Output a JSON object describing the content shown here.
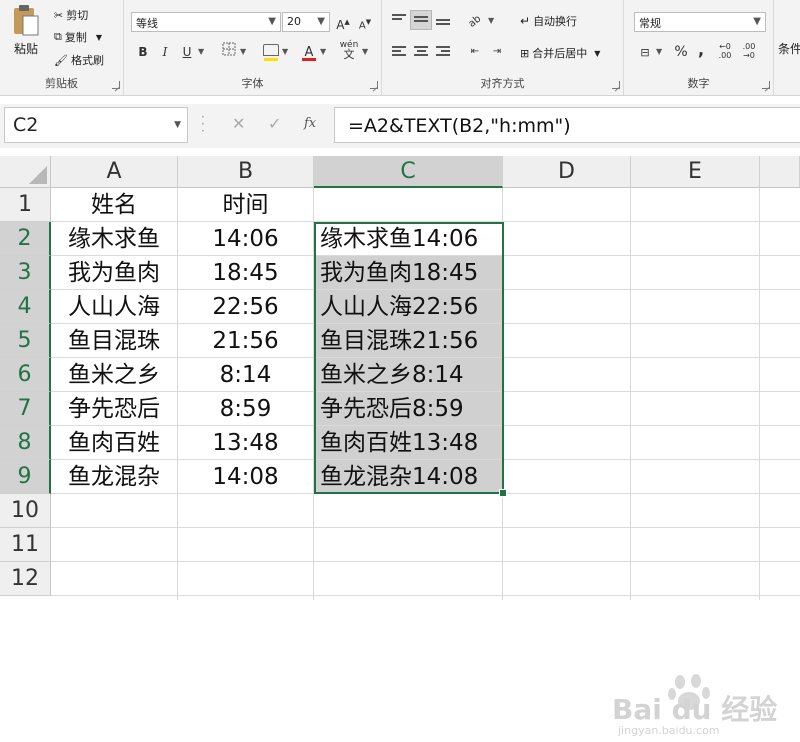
{
  "ribbon": {
    "clipboard": {
      "paste": "粘贴",
      "cut": "剪切",
      "copy": "复制",
      "format_painter": "格式刷",
      "label": "剪贴板"
    },
    "font": {
      "name": "等线",
      "size": "20",
      "bold": "B",
      "italic": "I",
      "underline": "U",
      "label": "字体",
      "wen": "wén"
    },
    "alignment": {
      "wrap": "自动换行",
      "merge": "合并后居中",
      "label": "对齐方式"
    },
    "number": {
      "format": "常规",
      "percent": "%",
      "comma": ",",
      "label": "数字"
    },
    "cut_off": "条件"
  },
  "formula_bar": {
    "name_box": "C2",
    "fx": "fx",
    "formula": "=A2&TEXT(B2,\"h:mm\")"
  },
  "sheet": {
    "columns": [
      "A",
      "B",
      "C",
      "D",
      "E"
    ],
    "selected_column": "C",
    "row_numbers": [
      "1",
      "2",
      "3",
      "4",
      "5",
      "6",
      "7",
      "8",
      "9",
      "10",
      "11",
      "12"
    ],
    "header_row": {
      "A": "姓名",
      "B": "时间"
    },
    "rows": [
      {
        "A": "缘木求鱼",
        "B": "14:06",
        "C": "缘木求鱼14:06"
      },
      {
        "A": "我为鱼肉",
        "B": "18:45",
        "C": "我为鱼肉18:45"
      },
      {
        "A": "人山人海",
        "B": "22:56",
        "C": "人山人海22:56"
      },
      {
        "A": "鱼目混珠",
        "B": "21:56",
        "C": "鱼目混珠21:56"
      },
      {
        "A": "鱼米之乡",
        "B": "8:14",
        "C": "鱼米之乡8:14"
      },
      {
        "A": "争先恐后",
        "B": "8:59",
        "C": "争先恐后8:59"
      },
      {
        "A": "鱼肉百姓",
        "B": "13:48",
        "C": "鱼肉百姓13:48"
      },
      {
        "A": "鱼龙混杂",
        "B": "14:08",
        "C": "鱼龙混杂14:08"
      }
    ]
  },
  "watermark": {
    "brand": "Bai du 经验",
    "url": "jingyan.baidu.com"
  },
  "colors": {
    "accent": "#217346",
    "selection": "#d0d0d0",
    "font_color": "#e02020",
    "highlight": "#ffe000"
  }
}
